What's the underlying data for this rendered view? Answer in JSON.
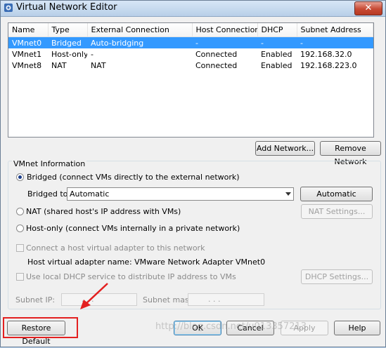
{
  "window": {
    "title": "Virtual Network Editor",
    "close_glyph": "✕"
  },
  "network_table": {
    "columns": [
      "Name",
      "Type",
      "External Connection",
      "Host Connection",
      "DHCP",
      "Subnet Address"
    ],
    "rows": [
      {
        "name": "VMnet0",
        "type": "Bridged",
        "external": "Auto-bridging",
        "host": "-",
        "dhcp": "-",
        "subnet": "-",
        "selected": true
      },
      {
        "name": "VMnet1",
        "type": "Host-only",
        "external": "-",
        "host": "Connected",
        "dhcp": "Enabled",
        "subnet": "192.168.32.0",
        "selected": false
      },
      {
        "name": "VMnet8",
        "type": "NAT",
        "external": "NAT",
        "host": "Connected",
        "dhcp": "Enabled",
        "subnet": "192.168.223.0",
        "selected": false
      }
    ]
  },
  "buttons": {
    "add_network": "Add Network...",
    "remove_network": "Remove Network",
    "automatic_settings": "Automatic Settings...",
    "nat_settings": "NAT Settings...",
    "dhcp_settings": "DHCP Settings...",
    "restore_default": "Restore Default",
    "ok": "OK",
    "cancel": "Cancel",
    "apply": "Apply",
    "help": "Help"
  },
  "vmnet_info": {
    "group_label": "VMnet Information",
    "bridged_label": "Bridged (connect VMs directly to the external network)",
    "bridged_to_label": "Bridged to:",
    "bridged_to_value": "Automatic",
    "nat_label": "NAT (shared host's IP address with VMs)",
    "host_only_label": "Host-only (connect VMs internally in a private network)",
    "connect_adapter_label": "Connect a host virtual adapter to this network",
    "adapter_name_label": "Host virtual adapter name: VMware Network Adapter VMnet0",
    "dhcp_label": "Use local DHCP service to distribute IP address to VMs",
    "subnet_ip_label": "Subnet IP:",
    "subnet_mask_label": "Subnet mask:",
    "subnet_ip_value": ".   .   .",
    "subnet_mask_value": ".   .   .",
    "selected_mode": "bridged"
  },
  "watermark": "http://blog.csdn.net/u013357213",
  "colors": {
    "selection": "#3399ff",
    "highlight": "#e32020"
  }
}
